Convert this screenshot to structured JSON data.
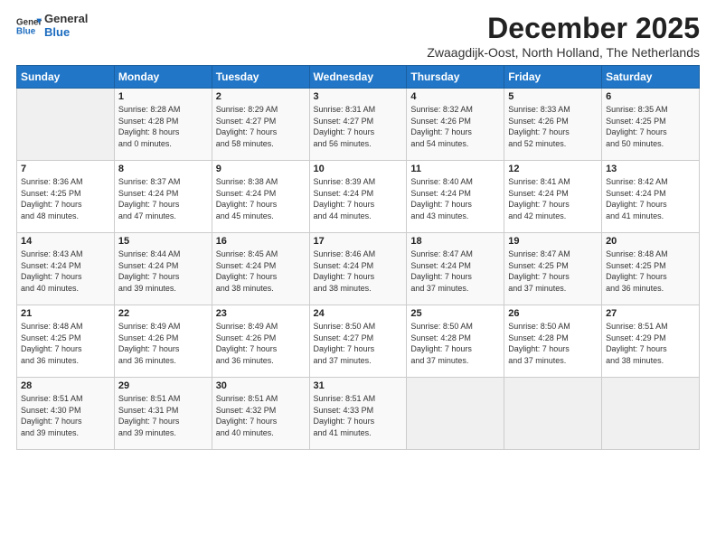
{
  "logo": {
    "general": "General",
    "blue": "Blue"
  },
  "title": "December 2025",
  "subtitle": "Zwaagdijk-Oost, North Holland, The Netherlands",
  "days_of_week": [
    "Sunday",
    "Monday",
    "Tuesday",
    "Wednesday",
    "Thursday",
    "Friday",
    "Saturday"
  ],
  "weeks": [
    [
      {
        "num": "",
        "info": ""
      },
      {
        "num": "1",
        "info": "Sunrise: 8:28 AM\nSunset: 4:28 PM\nDaylight: 8 hours\nand 0 minutes."
      },
      {
        "num": "2",
        "info": "Sunrise: 8:29 AM\nSunset: 4:27 PM\nDaylight: 7 hours\nand 58 minutes."
      },
      {
        "num": "3",
        "info": "Sunrise: 8:31 AM\nSunset: 4:27 PM\nDaylight: 7 hours\nand 56 minutes."
      },
      {
        "num": "4",
        "info": "Sunrise: 8:32 AM\nSunset: 4:26 PM\nDaylight: 7 hours\nand 54 minutes."
      },
      {
        "num": "5",
        "info": "Sunrise: 8:33 AM\nSunset: 4:26 PM\nDaylight: 7 hours\nand 52 minutes."
      },
      {
        "num": "6",
        "info": "Sunrise: 8:35 AM\nSunset: 4:25 PM\nDaylight: 7 hours\nand 50 minutes."
      }
    ],
    [
      {
        "num": "7",
        "info": "Sunrise: 8:36 AM\nSunset: 4:25 PM\nDaylight: 7 hours\nand 48 minutes."
      },
      {
        "num": "8",
        "info": "Sunrise: 8:37 AM\nSunset: 4:24 PM\nDaylight: 7 hours\nand 47 minutes."
      },
      {
        "num": "9",
        "info": "Sunrise: 8:38 AM\nSunset: 4:24 PM\nDaylight: 7 hours\nand 45 minutes."
      },
      {
        "num": "10",
        "info": "Sunrise: 8:39 AM\nSunset: 4:24 PM\nDaylight: 7 hours\nand 44 minutes."
      },
      {
        "num": "11",
        "info": "Sunrise: 8:40 AM\nSunset: 4:24 PM\nDaylight: 7 hours\nand 43 minutes."
      },
      {
        "num": "12",
        "info": "Sunrise: 8:41 AM\nSunset: 4:24 PM\nDaylight: 7 hours\nand 42 minutes."
      },
      {
        "num": "13",
        "info": "Sunrise: 8:42 AM\nSunset: 4:24 PM\nDaylight: 7 hours\nand 41 minutes."
      }
    ],
    [
      {
        "num": "14",
        "info": "Sunrise: 8:43 AM\nSunset: 4:24 PM\nDaylight: 7 hours\nand 40 minutes."
      },
      {
        "num": "15",
        "info": "Sunrise: 8:44 AM\nSunset: 4:24 PM\nDaylight: 7 hours\nand 39 minutes."
      },
      {
        "num": "16",
        "info": "Sunrise: 8:45 AM\nSunset: 4:24 PM\nDaylight: 7 hours\nand 38 minutes."
      },
      {
        "num": "17",
        "info": "Sunrise: 8:46 AM\nSunset: 4:24 PM\nDaylight: 7 hours\nand 38 minutes."
      },
      {
        "num": "18",
        "info": "Sunrise: 8:47 AM\nSunset: 4:24 PM\nDaylight: 7 hours\nand 37 minutes."
      },
      {
        "num": "19",
        "info": "Sunrise: 8:47 AM\nSunset: 4:25 PM\nDaylight: 7 hours\nand 37 minutes."
      },
      {
        "num": "20",
        "info": "Sunrise: 8:48 AM\nSunset: 4:25 PM\nDaylight: 7 hours\nand 36 minutes."
      }
    ],
    [
      {
        "num": "21",
        "info": "Sunrise: 8:48 AM\nSunset: 4:25 PM\nDaylight: 7 hours\nand 36 minutes."
      },
      {
        "num": "22",
        "info": "Sunrise: 8:49 AM\nSunset: 4:26 PM\nDaylight: 7 hours\nand 36 minutes."
      },
      {
        "num": "23",
        "info": "Sunrise: 8:49 AM\nSunset: 4:26 PM\nDaylight: 7 hours\nand 36 minutes."
      },
      {
        "num": "24",
        "info": "Sunrise: 8:50 AM\nSunset: 4:27 PM\nDaylight: 7 hours\nand 37 minutes."
      },
      {
        "num": "25",
        "info": "Sunrise: 8:50 AM\nSunset: 4:28 PM\nDaylight: 7 hours\nand 37 minutes."
      },
      {
        "num": "26",
        "info": "Sunrise: 8:50 AM\nSunset: 4:28 PM\nDaylight: 7 hours\nand 37 minutes."
      },
      {
        "num": "27",
        "info": "Sunrise: 8:51 AM\nSunset: 4:29 PM\nDaylight: 7 hours\nand 38 minutes."
      }
    ],
    [
      {
        "num": "28",
        "info": "Sunrise: 8:51 AM\nSunset: 4:30 PM\nDaylight: 7 hours\nand 39 minutes."
      },
      {
        "num": "29",
        "info": "Sunrise: 8:51 AM\nSunset: 4:31 PM\nDaylight: 7 hours\nand 39 minutes."
      },
      {
        "num": "30",
        "info": "Sunrise: 8:51 AM\nSunset: 4:32 PM\nDaylight: 7 hours\nand 40 minutes."
      },
      {
        "num": "31",
        "info": "Sunrise: 8:51 AM\nSunset: 4:33 PM\nDaylight: 7 hours\nand 41 minutes."
      },
      {
        "num": "",
        "info": ""
      },
      {
        "num": "",
        "info": ""
      },
      {
        "num": "",
        "info": ""
      }
    ]
  ]
}
